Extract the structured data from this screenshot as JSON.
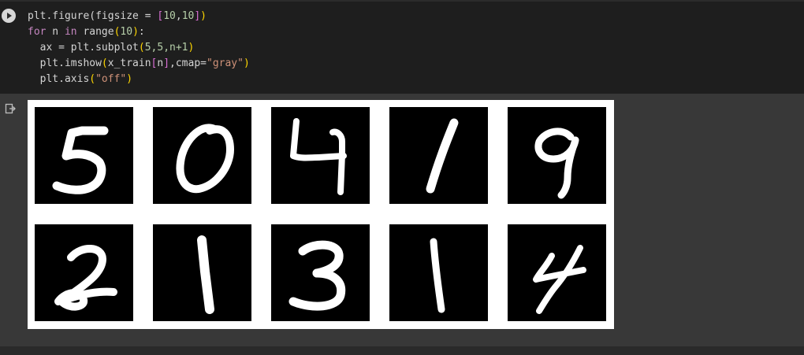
{
  "code_cell": {
    "lines": [
      {
        "parts": [
          {
            "t": "plt.figure(figsize = "
          },
          {
            "t": "[",
            "c": "br2"
          },
          {
            "t": "10",
            "c": "num"
          },
          {
            "t": ",",
            "c": "fn"
          },
          {
            "t": "10",
            "c": "num"
          },
          {
            "t": "]",
            "c": "br2"
          },
          {
            "t": ")",
            "c": "br1"
          }
        ]
      },
      {
        "parts": [
          {
            "t": "for",
            "c": "kw"
          },
          {
            "t": " n "
          },
          {
            "t": "in",
            "c": "kw"
          },
          {
            "t": " range"
          },
          {
            "t": "(",
            "c": "br1"
          },
          {
            "t": "10",
            "c": "num"
          },
          {
            "t": ")",
            "c": "br1"
          },
          {
            "t": ":"
          }
        ]
      },
      {
        "parts": [
          {
            "t": "  ax = plt.subplot"
          },
          {
            "t": "(",
            "c": "br1"
          },
          {
            "t": "5,5,n+1",
            "c": "num"
          },
          {
            "t": ")",
            "c": "br1"
          }
        ]
      },
      {
        "parts": [
          {
            "t": "  plt.imshow"
          },
          {
            "t": "(",
            "c": "br1"
          },
          {
            "t": "x_train"
          },
          {
            "t": "[",
            "c": "br2"
          },
          {
            "t": "n"
          },
          {
            "t": "]",
            "c": "br2"
          },
          {
            "t": ",cmap="
          },
          {
            "t": "\"gray\"",
            "c": "str"
          },
          {
            "t": ")",
            "c": "br1"
          }
        ]
      },
      {
        "parts": [
          {
            "t": "  plt.axis"
          },
          {
            "t": "(",
            "c": "br1"
          },
          {
            "t": "\"off\"",
            "c": "str"
          },
          {
            "t": ")",
            "c": "br1"
          }
        ]
      }
    ]
  },
  "output": {
    "icon": "output-redirect-icon",
    "digits": [
      "5",
      "0",
      "4",
      "1",
      "9",
      "2",
      "1",
      "3",
      "1",
      "4"
    ]
  },
  "colors": {
    "code_bg": "#1e1e1e",
    "output_bg": "#383838",
    "figure_bg": "#ffffff",
    "digit_bg": "#000000"
  }
}
